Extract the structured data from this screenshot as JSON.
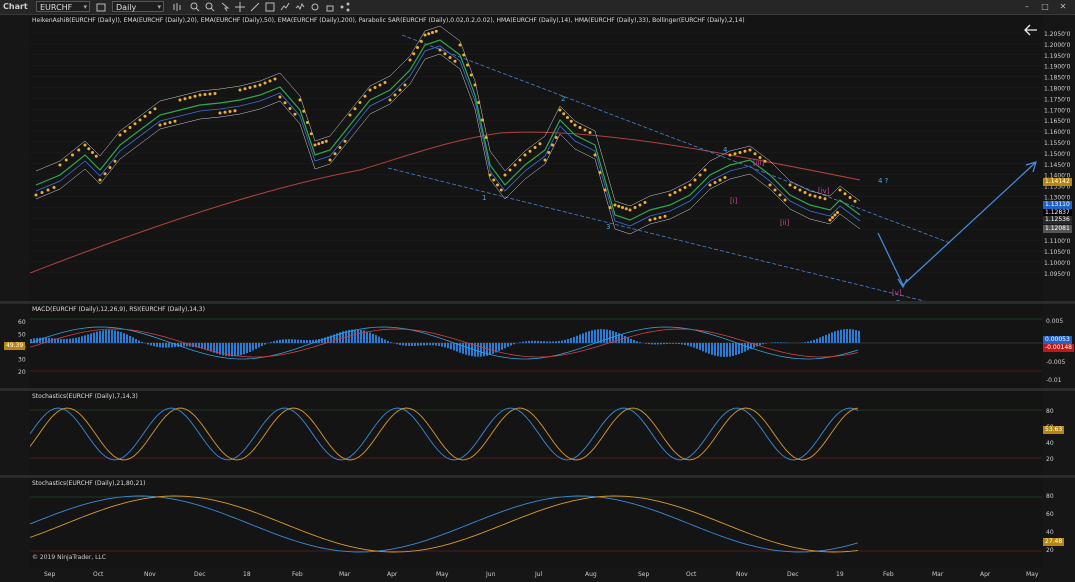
{
  "toolbar": {
    "chart_label": "Chart",
    "instrument": "EURCHF",
    "interval": "Daily"
  },
  "panels": {
    "price_label": "HeikenAshi8(EURCHF (Daily)), EMA(EURCHF (Daily),20), EMA(EURCHF (Daily),50), EMA(EURCHF (Daily),200), Parabolic SAR(EURCHF (Daily),0.02,0.2,0.02), HMA(EURCHF (Daily),14), HMA(EURCHF (Daily),33), Bollinger(EURCHF (Daily),2,14)",
    "macd_label": "MACD(EURCHF (Daily),12,26,9), RSI(EURCHF (Daily),14,3)",
    "stoch1_label": "Stochastics(EURCHF (Daily),7,14,3)",
    "stoch2_label": "Stochastics(EURCHF (Daily),21,80,21)",
    "copyright": "© 2019 NinjaTrader, LLC"
  },
  "price_axis": [
    "1.2050'0",
    "1.2000'0",
    "1.1950'0",
    "1.1900'0",
    "1.1850'0",
    "1.1800'0",
    "1.1750'0",
    "1.1700'0",
    "1.1650'0",
    "1.1600'0",
    "1.1550'0",
    "1.1500'0",
    "1.1450'0",
    "1.1400'0",
    "1.1350'0",
    "1.1300'0",
    "1.1250'0",
    "1.1200'0",
    "1.1150'0",
    "1.1100'0",
    "1.1050'0",
    "1.1000'0",
    "1.0950'0"
  ],
  "price_tags": {
    "t1": "1.14142",
    "t2": "1.13110",
    "t3": "1.12837",
    "t4": "1.12536",
    "t5": "1.12081"
  },
  "macd_axis": {
    "left": [
      "60",
      "50",
      "40",
      "30",
      "20"
    ],
    "right": [
      "0.005",
      "-0.005",
      "-0.01"
    ]
  },
  "macd_tags": {
    "rsi": "49.39",
    "macd1": "0.00053",
    "macd2": "-0.00148"
  },
  "stoch1_axis": [
    "80",
    "60",
    "40",
    "20"
  ],
  "stoch1_tag": "53.63",
  "stoch2_axis": [
    "80",
    "60",
    "40",
    "20"
  ],
  "stoch2_tag": "27.48",
  "wave_labels": {
    "w1": "1",
    "w2": "2",
    "w3": "3",
    "w4": "4",
    "w4q": "4 ?",
    "w5": "5",
    "i": "[i]",
    "ii": "[ii]",
    "iii": "[iii]",
    "iv": "[iv]",
    "v": "[v]"
  },
  "x_axis": [
    "Sep",
    "Oct",
    "Nov",
    "Dec",
    "18",
    "Feb",
    "Mar",
    "Apr",
    "May",
    "Jun",
    "Jul",
    "Aug",
    "Sep",
    "Oct",
    "Nov",
    "Dec",
    "19",
    "Feb",
    "Mar",
    "Apr",
    "May"
  ],
  "colors": {
    "background": "#141414",
    "sar": "#f0b030",
    "ema200": "#b04040",
    "trendline": "#4a7fd4",
    "wave_blue": "#4ca6e0",
    "wave_pink": "#d040a0",
    "macd_hist": "#2a7ad8",
    "stoch_blue": "#3a8ad8",
    "stoch_orange": "#d89a30",
    "tag_black": "#000000",
    "tag_blue": "#1f63c8",
    "tag_red": "#c01818",
    "tag_gold": "#b8860b"
  }
}
